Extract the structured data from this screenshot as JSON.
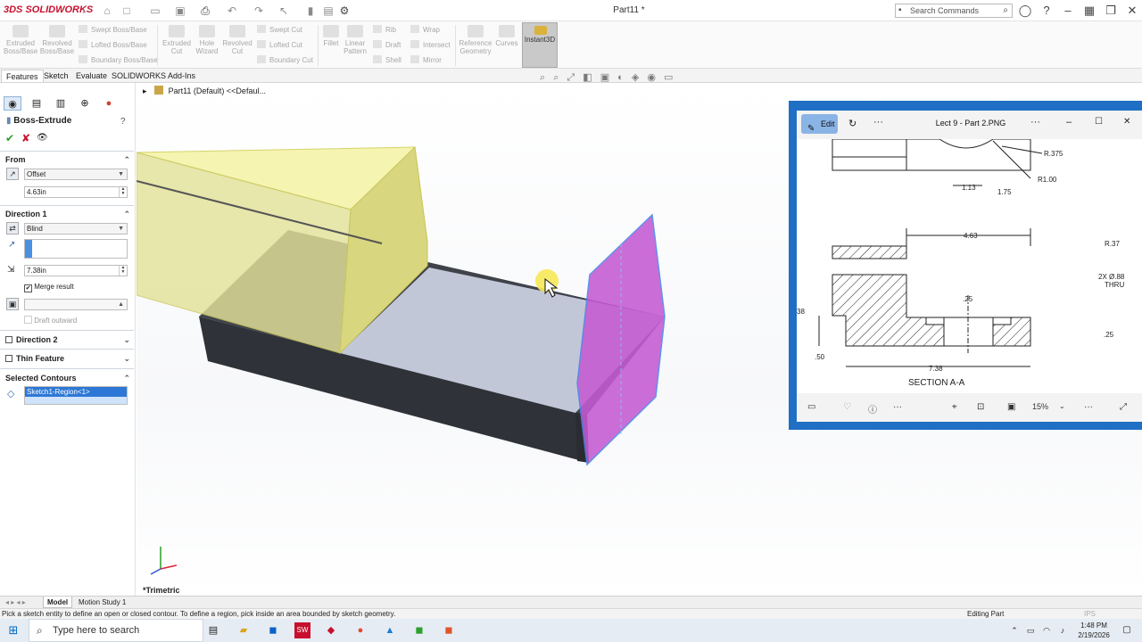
{
  "app": {
    "logo": "3DS SOLIDWORKS",
    "doc_title": "Part11 *",
    "search_placeholder": "Search Commands"
  },
  "ribbon": {
    "extruded_boss": "Extruded Boss/Base",
    "revolved_boss": "Revolved Boss/Base",
    "swept_boss": "Swept Boss/Base",
    "lofted_boss": "Lofted Boss/Base",
    "boundary_boss": "Boundary Boss/Base",
    "extruded_cut": "Extruded Cut",
    "hole_wizard": "Hole Wizard",
    "revolved_cut": "Revolved Cut",
    "swept_cut": "Swept Cut",
    "lofted_cut": "Lofted Cut",
    "boundary_cut": "Boundary Cut",
    "fillet": "Fillet",
    "linear_pattern": "Linear Pattern",
    "rib": "Rib",
    "draft": "Draft",
    "shell": "Shell",
    "wrap": "Wrap",
    "intersect": "Intersect",
    "mirror": "Mirror",
    "reference_geometry": "Reference Geometry",
    "curves": "Curves",
    "instant3d": "Instant3D"
  },
  "command_tabs": [
    "Features",
    "Sketch",
    "Evaluate",
    "SOLIDWORKS Add-Ins"
  ],
  "property_manager": {
    "title": "Boss-Extrude",
    "from_label": "From",
    "from_value": "Offset",
    "offset_value": "4.63in",
    "dir1_label": "Direction 1",
    "dir1_type": "Blind",
    "depth_value": "7.38in",
    "merge_result": "Merge result",
    "draft_outward": "Draft outward",
    "dir2_label": "Direction 2",
    "thin_label": "Thin Feature",
    "contours_label": "Selected Contours",
    "contour_item": "Sketch1-Region<1>"
  },
  "tree": {
    "root": "Part11 (Default) <<Defaul..."
  },
  "viewport": {
    "view_name": "*Trimetric"
  },
  "photos": {
    "edit_label": "Edit",
    "file_title": "Lect 9 - Part 2.PNG",
    "zoom": "15%",
    "drawing": {
      "r375": "R.375",
      "r100": "R1.00",
      "d113": "1.13",
      "d175": "1.75",
      "d463": "4.63",
      "r37": "R.37",
      "hole": "2X Ø.88",
      "thru": "THRU",
      "d25a": ".25",
      "d25b": ".25",
      "d50": ".50",
      "d738": "7.38",
      "d38": "38",
      "section": "SECTION A-A"
    }
  },
  "bottom_tabs": [
    "Model",
    "Motion Study 1"
  ],
  "status": {
    "hint": "Pick a sketch entity to define an open or closed contour. To define a region, pick inside an area bounded by sketch geometry.",
    "mode": "Editing Part",
    "units": "IPS"
  },
  "taskbar": {
    "search_placeholder": "Type here to search",
    "time": "1:48 PM",
    "date": "2/19/2026"
  },
  "colors": {
    "accent_blue": "#1f6fc5",
    "preview_yellow": "#f4f3a6",
    "selected_face_magenta": "#c45ad2",
    "brand_red": "#c8102e"
  }
}
